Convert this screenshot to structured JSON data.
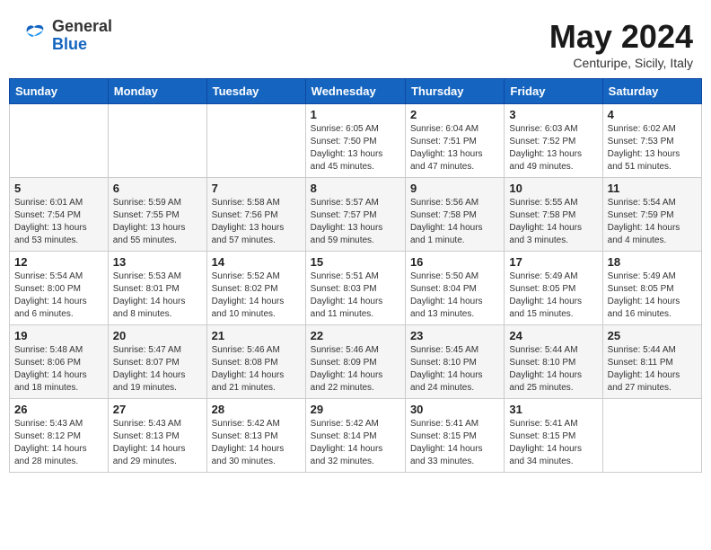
{
  "header": {
    "logo_line1": "General",
    "logo_line2": "Blue",
    "month": "May 2024",
    "location": "Centuripe, Sicily, Italy"
  },
  "weekdays": [
    "Sunday",
    "Monday",
    "Tuesday",
    "Wednesday",
    "Thursday",
    "Friday",
    "Saturday"
  ],
  "weeks": [
    [
      {
        "day": "",
        "info": ""
      },
      {
        "day": "",
        "info": ""
      },
      {
        "day": "",
        "info": ""
      },
      {
        "day": "1",
        "info": "Sunrise: 6:05 AM\nSunset: 7:50 PM\nDaylight: 13 hours\nand 45 minutes."
      },
      {
        "day": "2",
        "info": "Sunrise: 6:04 AM\nSunset: 7:51 PM\nDaylight: 13 hours\nand 47 minutes."
      },
      {
        "day": "3",
        "info": "Sunrise: 6:03 AM\nSunset: 7:52 PM\nDaylight: 13 hours\nand 49 minutes."
      },
      {
        "day": "4",
        "info": "Sunrise: 6:02 AM\nSunset: 7:53 PM\nDaylight: 13 hours\nand 51 minutes."
      }
    ],
    [
      {
        "day": "5",
        "info": "Sunrise: 6:01 AM\nSunset: 7:54 PM\nDaylight: 13 hours\nand 53 minutes."
      },
      {
        "day": "6",
        "info": "Sunrise: 5:59 AM\nSunset: 7:55 PM\nDaylight: 13 hours\nand 55 minutes."
      },
      {
        "day": "7",
        "info": "Sunrise: 5:58 AM\nSunset: 7:56 PM\nDaylight: 13 hours\nand 57 minutes."
      },
      {
        "day": "8",
        "info": "Sunrise: 5:57 AM\nSunset: 7:57 PM\nDaylight: 13 hours\nand 59 minutes."
      },
      {
        "day": "9",
        "info": "Sunrise: 5:56 AM\nSunset: 7:58 PM\nDaylight: 14 hours\nand 1 minute."
      },
      {
        "day": "10",
        "info": "Sunrise: 5:55 AM\nSunset: 7:58 PM\nDaylight: 14 hours\nand 3 minutes."
      },
      {
        "day": "11",
        "info": "Sunrise: 5:54 AM\nSunset: 7:59 PM\nDaylight: 14 hours\nand 4 minutes."
      }
    ],
    [
      {
        "day": "12",
        "info": "Sunrise: 5:54 AM\nSunset: 8:00 PM\nDaylight: 14 hours\nand 6 minutes."
      },
      {
        "day": "13",
        "info": "Sunrise: 5:53 AM\nSunset: 8:01 PM\nDaylight: 14 hours\nand 8 minutes."
      },
      {
        "day": "14",
        "info": "Sunrise: 5:52 AM\nSunset: 8:02 PM\nDaylight: 14 hours\nand 10 minutes."
      },
      {
        "day": "15",
        "info": "Sunrise: 5:51 AM\nSunset: 8:03 PM\nDaylight: 14 hours\nand 11 minutes."
      },
      {
        "day": "16",
        "info": "Sunrise: 5:50 AM\nSunset: 8:04 PM\nDaylight: 14 hours\nand 13 minutes."
      },
      {
        "day": "17",
        "info": "Sunrise: 5:49 AM\nSunset: 8:05 PM\nDaylight: 14 hours\nand 15 minutes."
      },
      {
        "day": "18",
        "info": "Sunrise: 5:49 AM\nSunset: 8:05 PM\nDaylight: 14 hours\nand 16 minutes."
      }
    ],
    [
      {
        "day": "19",
        "info": "Sunrise: 5:48 AM\nSunset: 8:06 PM\nDaylight: 14 hours\nand 18 minutes."
      },
      {
        "day": "20",
        "info": "Sunrise: 5:47 AM\nSunset: 8:07 PM\nDaylight: 14 hours\nand 19 minutes."
      },
      {
        "day": "21",
        "info": "Sunrise: 5:46 AM\nSunset: 8:08 PM\nDaylight: 14 hours\nand 21 minutes."
      },
      {
        "day": "22",
        "info": "Sunrise: 5:46 AM\nSunset: 8:09 PM\nDaylight: 14 hours\nand 22 minutes."
      },
      {
        "day": "23",
        "info": "Sunrise: 5:45 AM\nSunset: 8:10 PM\nDaylight: 14 hours\nand 24 minutes."
      },
      {
        "day": "24",
        "info": "Sunrise: 5:44 AM\nSunset: 8:10 PM\nDaylight: 14 hours\nand 25 minutes."
      },
      {
        "day": "25",
        "info": "Sunrise: 5:44 AM\nSunset: 8:11 PM\nDaylight: 14 hours\nand 27 minutes."
      }
    ],
    [
      {
        "day": "26",
        "info": "Sunrise: 5:43 AM\nSunset: 8:12 PM\nDaylight: 14 hours\nand 28 minutes."
      },
      {
        "day": "27",
        "info": "Sunrise: 5:43 AM\nSunset: 8:13 PM\nDaylight: 14 hours\nand 29 minutes."
      },
      {
        "day": "28",
        "info": "Sunrise: 5:42 AM\nSunset: 8:13 PM\nDaylight: 14 hours\nand 30 minutes."
      },
      {
        "day": "29",
        "info": "Sunrise: 5:42 AM\nSunset: 8:14 PM\nDaylight: 14 hours\nand 32 minutes."
      },
      {
        "day": "30",
        "info": "Sunrise: 5:41 AM\nSunset: 8:15 PM\nDaylight: 14 hours\nand 33 minutes."
      },
      {
        "day": "31",
        "info": "Sunrise: 5:41 AM\nSunset: 8:15 PM\nDaylight: 14 hours\nand 34 minutes."
      },
      {
        "day": "",
        "info": ""
      }
    ]
  ]
}
